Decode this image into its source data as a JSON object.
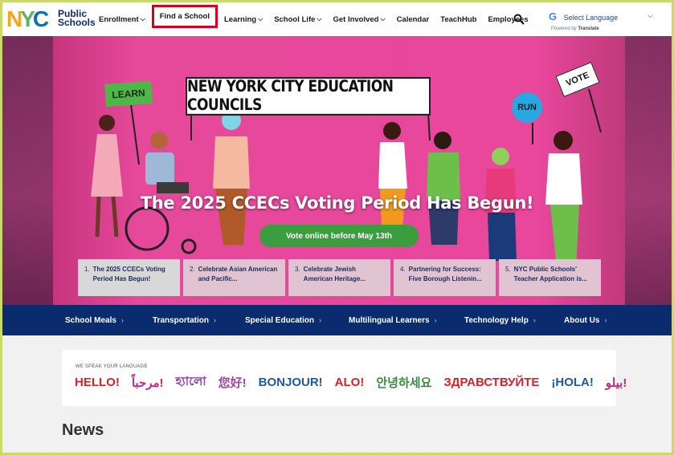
{
  "header": {
    "logo_text": "NYC",
    "logo_line1": "Public",
    "logo_line2": "Schools",
    "nav": [
      {
        "label": "Enrollment",
        "dropdown": true
      },
      {
        "label": "Find a School",
        "dropdown": false,
        "highlighted": true
      },
      {
        "label": "Learning",
        "dropdown": true
      },
      {
        "label": "School Life",
        "dropdown": true
      },
      {
        "label": "Get Involved",
        "dropdown": true
      },
      {
        "label": "Calendar",
        "dropdown": false
      },
      {
        "label": "TeachHub",
        "dropdown": false
      },
      {
        "label": "Employees",
        "dropdown": false
      }
    ],
    "search_icon": "search-icon",
    "language": {
      "g_glyph": "G",
      "select_label": "Select Language",
      "powered_prefix": "Powered by",
      "powered_brand": "Translate"
    }
  },
  "hero": {
    "banner_text": "NEW YORK CITY EDUCATION COUNCILS",
    "sign_learn": "LEARN",
    "sign_run": "RUN",
    "sign_vote": "VOTE",
    "title": "The 2025 CCECs Voting Period Has Begun!",
    "cta_label": "Vote online before May 13th",
    "slides": [
      {
        "num": "1.",
        "text": "The 2025 CCECs Voting Period Has Begun!",
        "active": true
      },
      {
        "num": "2.",
        "text": "Celebrate Asian American and Pacific...",
        "active": false
      },
      {
        "num": "3.",
        "text": "Celebrate Jewish American Heritage...",
        "active": false
      },
      {
        "num": "4.",
        "text": "Partnering for Success: Five Borough Listenin...",
        "active": false
      },
      {
        "num": "5.",
        "text": "NYC Public Schools' Teacher Application is...",
        "active": false
      }
    ]
  },
  "quick_links": [
    {
      "label": "School Meals",
      "arrow": "›"
    },
    {
      "label": "Transportation",
      "arrow": "›"
    },
    {
      "label": "Special Education",
      "arrow": "›"
    },
    {
      "label": "Multilingual Learners",
      "arrow": "›"
    },
    {
      "label": "Technology Help",
      "arrow": "›"
    },
    {
      "label": "About Us",
      "arrow": "›"
    }
  ],
  "languages": {
    "caption": "WE SPEAK YOUR LANGUAGE",
    "greetings": [
      {
        "text": "HELLO!",
        "color": "#d6232a"
      },
      {
        "text": "مرحباً!",
        "color": "#c2268a"
      },
      {
        "text": "হ্যালো",
        "color": "#8a3f9e"
      },
      {
        "text": "您好!",
        "color": "#a3489e"
      },
      {
        "text": "BONJOUR!",
        "color": "#1d5aa6"
      },
      {
        "text": "ALO!",
        "color": "#d6232a"
      },
      {
        "text": "안녕하세요",
        "color": "#3a8a3f"
      },
      {
        "text": "ЗДРАВСТВУЙТЕ",
        "color": "#d6232a"
      },
      {
        "text": "¡HOLA!",
        "color": "#1d5aa6"
      },
      {
        "text": "بيلو!",
        "color": "#c2268a"
      }
    ]
  },
  "news_heading": "News",
  "colors": {
    "page_border": "#c9da6a",
    "navy": "#0a2b6e",
    "hero_pink": "#e8479c",
    "cta_green": "#3a9e3f",
    "highlight_red": "#d6001c"
  }
}
